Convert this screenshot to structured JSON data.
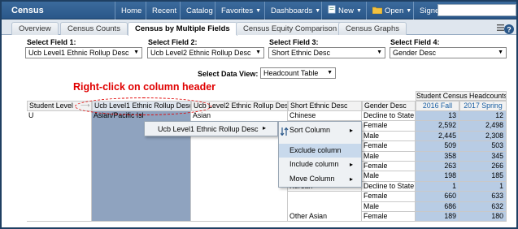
{
  "topbar": {
    "brand": "Census",
    "nav": [
      {
        "label": "Home",
        "caret": false,
        "glyph": ""
      },
      {
        "label": "Recent",
        "caret": false,
        "glyph": ""
      },
      {
        "label": "Catalog",
        "caret": false,
        "glyph": ""
      },
      {
        "label": "Favorites",
        "caret": true,
        "glyph": ""
      },
      {
        "label": "Dashboards",
        "caret": true,
        "glyph": ""
      },
      {
        "label": "New",
        "caret": true,
        "glyph": "new-icon"
      },
      {
        "label": "Open",
        "caret": true,
        "glyph": "folder-icon"
      },
      {
        "label": "Signed In As",
        "caret": false,
        "glyph": ""
      }
    ]
  },
  "tabs": [
    "Overview",
    "Census Counts",
    "Census by Multiple Fields",
    "Census Equity Comparison",
    "Census Graphs"
  ],
  "fields": [
    {
      "label": "Select Field 1:",
      "value": "Ucb Level1 Ethnic Rollup Desc"
    },
    {
      "label": "Select Field 2:",
      "value": "Ucb Level2 Ethnic Rollup Desc"
    },
    {
      "label": "Select Field 3:",
      "value": "Short Ethnic Desc"
    },
    {
      "label": "Select Field 4:",
      "value": "Gender Desc"
    }
  ],
  "data_view": {
    "label": "Select Data View:",
    "value": "Headcount Table"
  },
  "annotation": "Right-click on column header",
  "table": {
    "group_header": "Student Census Headcounts",
    "headers": [
      "Student Level",
      "Ucb Level1 Ethnic Rollup Desc",
      "Ucb Level2 Ethnic Rollup Desc",
      "Short Ethnic Desc",
      "Gender Desc",
      "2016 Fall",
      "2017 Spring"
    ],
    "student_level": "U",
    "level1_value": "Asian/Pacific Isl",
    "level2_value": "Asian",
    "rows": [
      {
        "ethnic": "Chinese",
        "gender": "Decline to State",
        "fall": "13",
        "spring": "12"
      },
      {
        "ethnic": "",
        "gender": "Female",
        "fall": "2,592",
        "spring": "2,498"
      },
      {
        "ethnic": "",
        "gender": "Male",
        "fall": "2,445",
        "spring": "2,308"
      },
      {
        "ethnic": "",
        "gender": "Female",
        "fall": "509",
        "spring": "503"
      },
      {
        "ethnic": "",
        "gender": "Male",
        "fall": "358",
        "spring": "345"
      },
      {
        "ethnic": "",
        "gender": "Female",
        "fall": "263",
        "spring": "266"
      },
      {
        "ethnic": "",
        "gender": "Male",
        "fall": "198",
        "spring": "185"
      },
      {
        "ethnic": "Korean",
        "gender": "Decline to State",
        "fall": "1",
        "spring": "1"
      },
      {
        "ethnic": "",
        "gender": "Female",
        "fall": "660",
        "spring": "633"
      },
      {
        "ethnic": "",
        "gender": "Male",
        "fall": "686",
        "spring": "632"
      },
      {
        "ethnic": "Other Asian",
        "gender": "Female",
        "fall": "189",
        "spring": "180"
      }
    ]
  },
  "context_menu": {
    "column_item": "Ucb Level1 Ethnic Rollup Desc",
    "items": [
      {
        "label": "Sort Column",
        "submenu": true
      },
      {
        "label": "Exclude column",
        "submenu": false
      },
      {
        "label": "Include column",
        "submenu": true
      },
      {
        "label": "Move Column",
        "submenu": true
      }
    ]
  },
  "colors": {
    "topbar": "#2a5789",
    "annotation": "#e00000",
    "highlight_column": "#8fa3bf",
    "number_cells": "#b8cce4",
    "header_link": "#1a5fa3"
  }
}
